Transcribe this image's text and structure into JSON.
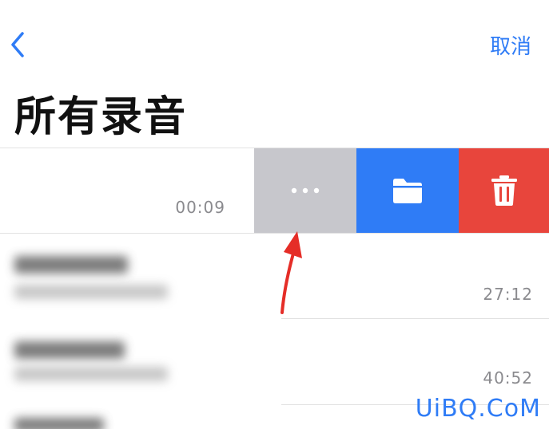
{
  "nav": {
    "cancel_label": "取消"
  },
  "page": {
    "title": "所有录音"
  },
  "recordings": [
    {
      "duration": "00:09"
    },
    {
      "duration": "27:12"
    },
    {
      "duration": "40:52"
    }
  ],
  "swipe_actions": {
    "more_icon": "ellipsis-icon",
    "folder_icon": "folder-icon",
    "delete_icon": "trash-icon"
  },
  "colors": {
    "accent": "#2f7cf6",
    "more_bg": "#c7c7cc",
    "folder_bg": "#2f7cf6",
    "delete_bg": "#e8453c",
    "annotation_arrow": "#e52d27"
  },
  "watermark": "UiBQ.CoM"
}
